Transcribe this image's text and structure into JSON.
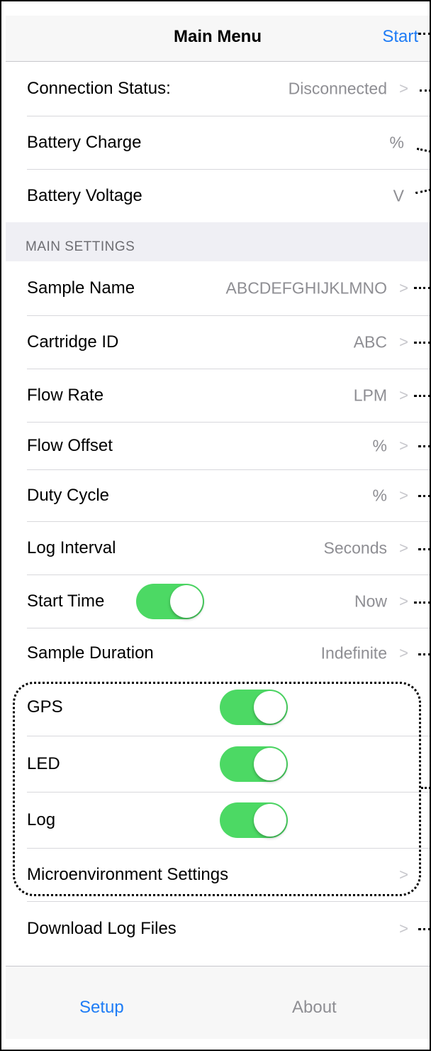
{
  "nav": {
    "title": "Main Menu",
    "action": "Start"
  },
  "status_rows": [
    {
      "label": "Connection Status:",
      "value": "Disconnected",
      "chevron": true
    },
    {
      "label": "Battery Charge",
      "value": "%",
      "chevron": false
    },
    {
      "label": "Battery Voltage",
      "value": "V",
      "chevron": false
    }
  ],
  "main_settings": {
    "header": "MAIN SETTINGS",
    "rows": [
      {
        "label": "Sample Name",
        "value": "ABCDEFGHIJKLMNO"
      },
      {
        "label": "Cartridge ID",
        "value": "ABC"
      },
      {
        "label": "Flow Rate",
        "value": "LPM"
      },
      {
        "label": "Flow Offset",
        "value": "%"
      },
      {
        "label": "Duty Cycle",
        "value": "%"
      },
      {
        "label": "Log Interval",
        "value": "Seconds"
      },
      {
        "label": "Start Time",
        "value": "Now",
        "toggle_on": true
      },
      {
        "label": "Sample Duration",
        "value": "Indefinite"
      }
    ]
  },
  "microenvironment": {
    "rows": [
      {
        "label": "GPS",
        "toggle_on": true
      },
      {
        "label": "LED",
        "toggle_on": true
      },
      {
        "label": "Log",
        "toggle_on": true
      },
      {
        "label": "Microenvironment Settings"
      }
    ]
  },
  "download": {
    "label": "Download Log Files"
  },
  "tabs": [
    {
      "label": "Setup",
      "active": true
    },
    {
      "label": "About",
      "active": false
    }
  ],
  "colors": {
    "accent": "#1e7cf6",
    "toggle_on": "#4cd964",
    "secondary_text": "#8e8e93"
  }
}
